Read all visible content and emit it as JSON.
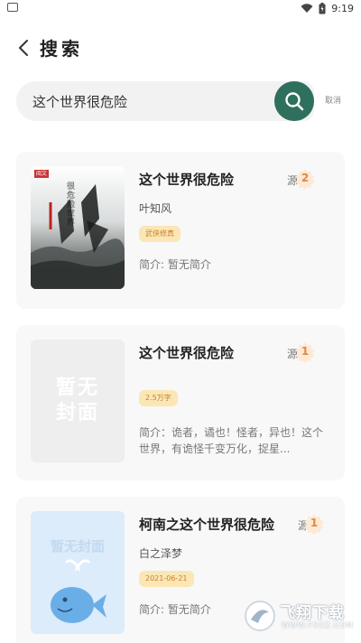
{
  "status_bar": {
    "time": "9:19"
  },
  "header": {
    "title": "搜索"
  },
  "search": {
    "value": "这个世界很危险",
    "cancel_label": "取消"
  },
  "results": [
    {
      "title": "这个世界很危险",
      "author": "叶知风",
      "tag": "武侠修真",
      "intro": "简介: 暂无简介",
      "source_label": "源",
      "source_count": "2",
      "cover": {
        "type": "image",
        "art_text": "很危险世界",
        "badge_text": "阅文"
      }
    },
    {
      "title": "这个世界很危险",
      "author": "",
      "tag": "2.5万字",
      "intro": "简介：诡者，谲也！怪者，异也！这个世界，有诡怪千变万化，捉星...",
      "source_label": "源",
      "source_count": "1",
      "cover": {
        "type": "placeholder-grey",
        "text": "暂无封面"
      }
    },
    {
      "title": "柯南之这个世界很危险",
      "author": "白之泽梦",
      "tag": "2021-06-21",
      "intro": "简介: 暂无简介",
      "source_label": "源",
      "source_count": "1",
      "cover": {
        "type": "placeholder-blue",
        "text": "暂无封面"
      }
    }
  ],
  "watermark": {
    "text": "飞翔下载",
    "url": "WWW.FXXZ.COM"
  },
  "colors": {
    "accent": "#2f6f5e",
    "tag_bg": "#fbe7b5",
    "tag_text": "#c9822a",
    "badge": "#d98b4a"
  }
}
